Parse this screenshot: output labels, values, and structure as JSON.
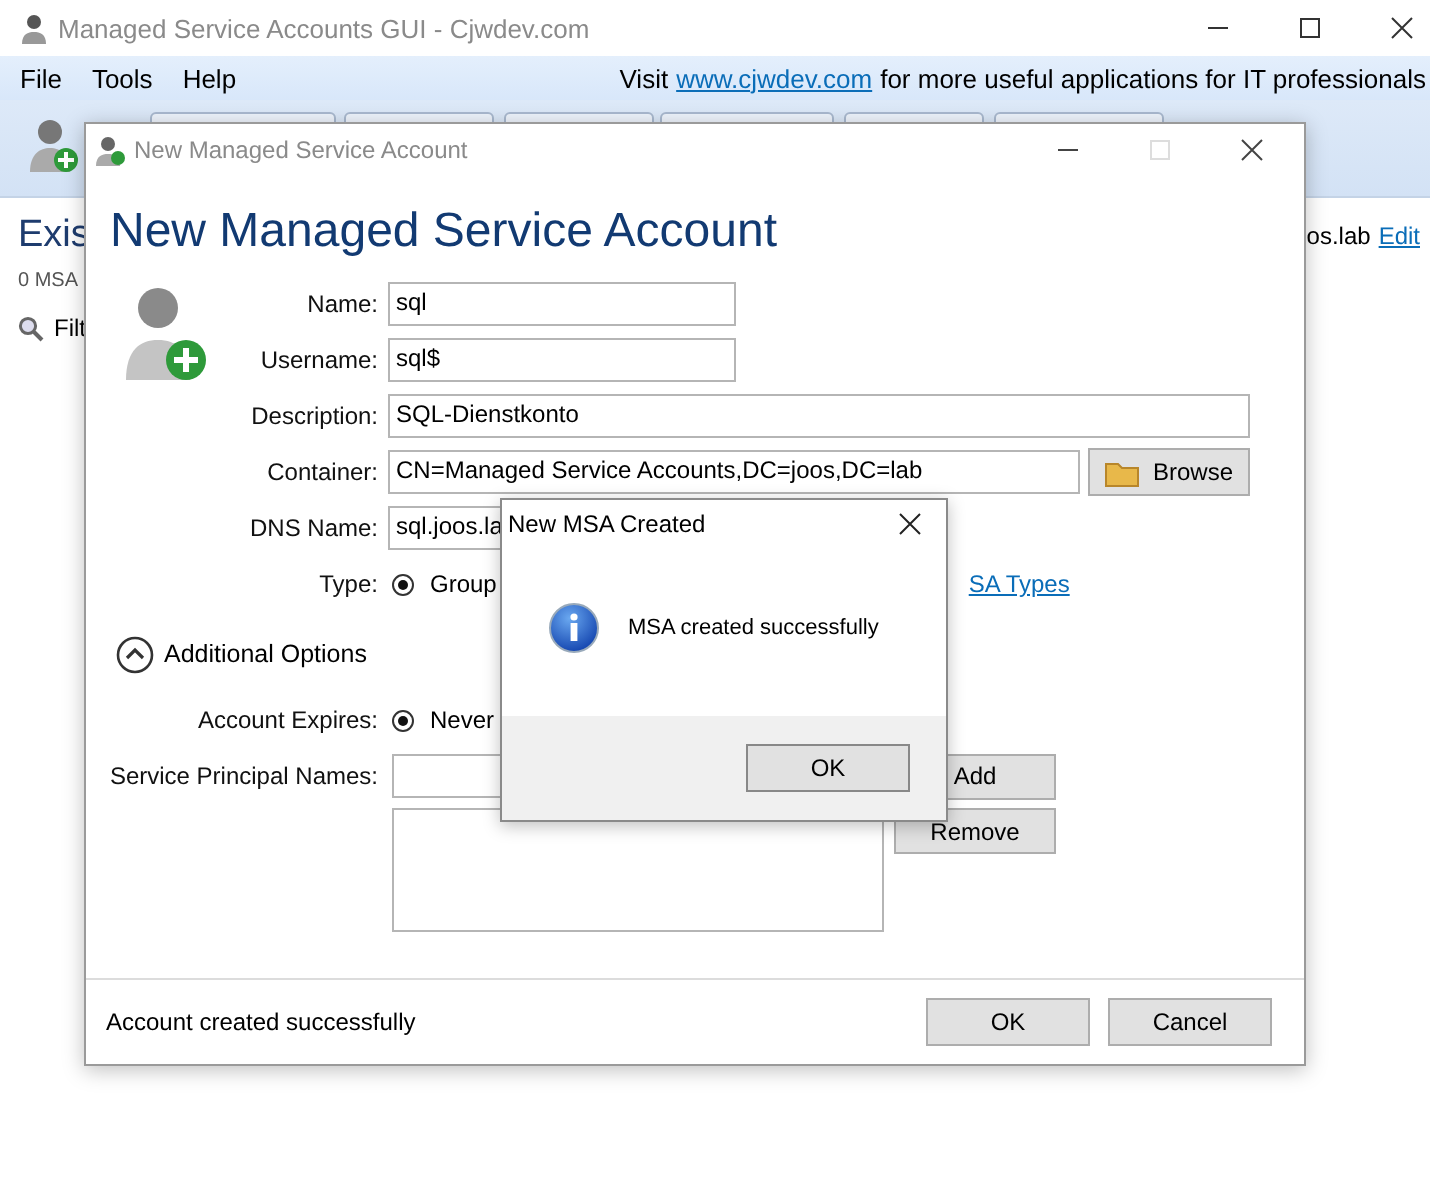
{
  "main_window": {
    "title": "Managed Service Accounts GUI - Cjwdev.com",
    "menu": [
      "File",
      "Tools",
      "Help"
    ],
    "promo": {
      "before": "Visit",
      "link": "www.cjwdev.com",
      "after": "for more useful applications for IT professionals"
    },
    "content": {
      "heading": "Exis",
      "count": "0 MSA",
      "filter": "Filt",
      "domain": "os.lab",
      "edit_link": "Edit"
    }
  },
  "dialog": {
    "title": "New Managed Service Account",
    "heading": "New Managed Service Account",
    "fields": [
      {
        "kind": "short",
        "label": "Name:",
        "value": "sql"
      },
      {
        "kind": "short",
        "label": "Username:",
        "value": "sql$"
      },
      {
        "kind": "wide",
        "label": "Description:",
        "value": "SQL-Dienstkonto"
      },
      {
        "kind": "browse",
        "label": "Container:",
        "value": "CN=Managed Service Accounts,DC=joos,DC=lab",
        "button": "Browse"
      },
      {
        "kind": "short",
        "label": "DNS Name:",
        "value": "sql.joos.la"
      }
    ],
    "type": {
      "label": "Type:",
      "option": {
        "label": "Group",
        "selected": true
      },
      "link": "SA Types"
    },
    "additional_options": {
      "label": "Additional Options",
      "expanded": true
    },
    "expires": {
      "label": "Account Expires:",
      "option": {
        "label": "Never",
        "selected": true
      }
    },
    "spn": {
      "label": "Service Principal Names:",
      "add": "Add",
      "remove": "Remove"
    },
    "status": "Account created successfully",
    "buttons": [
      "OK",
      "Cancel"
    ]
  },
  "message_box": {
    "title": "New MSA Created",
    "message": "MSA created successfully",
    "button": "OK"
  }
}
